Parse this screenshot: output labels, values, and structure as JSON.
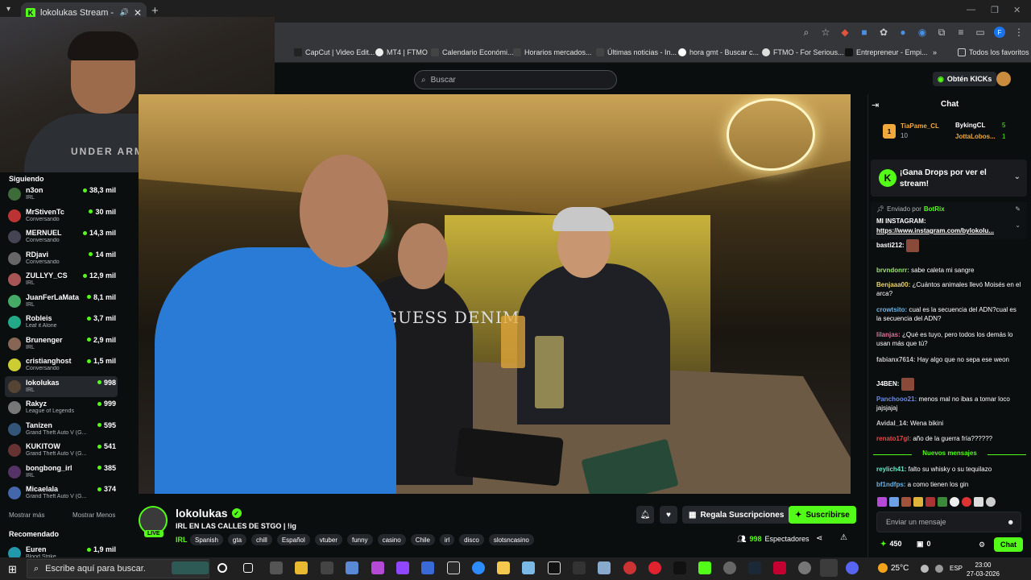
{
  "browser": {
    "tab_title": "lokolukas Stream - Watch L",
    "bookmarks": [
      "CapCut | Video Edit...",
      "MT4 | FTMO",
      "Calendario Económi...",
      "Horarios mercados...",
      "Últimas noticias - In...",
      "hora gmt - Buscar c...",
      "FTMO - For Serious...",
      "Entrepreneur - Empi...",
      "Todos los favoritos"
    ]
  },
  "header": {
    "search_placeholder": "Buscar",
    "get_kicks": "Obtén KICKs"
  },
  "webcam": {
    "shirt_text": "UNDER ARMOUR"
  },
  "sidebar": {
    "following_title": "Siguiendo",
    "following": [
      {
        "name": "n3on",
        "cat": "IRL",
        "viewers": "38,3 mil",
        "color": "#3d6b3a"
      },
      {
        "name": "MrStivenTc",
        "cat": "Conversando",
        "viewers": "30 mil",
        "color": "#b33"
      },
      {
        "name": "MERNUEL",
        "cat": "Conversando",
        "viewers": "14,3 mil",
        "color": "#445"
      },
      {
        "name": "RDjavi",
        "cat": "Conversando",
        "viewers": "14 mil",
        "color": "#666"
      },
      {
        "name": "ZULLYY_CS",
        "cat": "IRL",
        "viewers": "12,9 mil",
        "color": "#a55"
      },
      {
        "name": "JuanFerLaMata",
        "cat": "IRL",
        "viewers": "8,1 mil",
        "color": "#4a6"
      },
      {
        "name": "Robleis",
        "cat": "Leaf it Alone",
        "viewers": "3,7 mil",
        "color": "#2a8"
      },
      {
        "name": "Brunenger",
        "cat": "IRL",
        "viewers": "2,9 mil",
        "color": "#865"
      },
      {
        "name": "cristianghost",
        "cat": "Conversando",
        "viewers": "1,5 mil",
        "color": "#cc3"
      },
      {
        "name": "lokolukas",
        "cat": "IRL",
        "viewers": "998",
        "color": "#543"
      },
      {
        "name": "Rakyz",
        "cat": "League of Legends",
        "viewers": "999",
        "color": "#777"
      },
      {
        "name": "Tanizen",
        "cat": "Grand Theft Auto V (G...",
        "viewers": "595",
        "color": "#357"
      },
      {
        "name": "KUKITOW",
        "cat": "Grand Theft Auto V (G...",
        "viewers": "541",
        "color": "#633"
      },
      {
        "name": "bongbong_irl",
        "cat": "IRL",
        "viewers": "385",
        "color": "#536"
      },
      {
        "name": "Micaelala",
        "cat": "Grand Theft Auto V (G...",
        "viewers": "374",
        "color": "#46a"
      }
    ],
    "show_more": "Mostrar más",
    "show_less": "Mostrar Menos",
    "recommended_title": "Recomendado",
    "recommended": [
      {
        "name": "Euren",
        "cat": "Blood Strike",
        "viewers": "1,9 mil",
        "color": "#29a"
      }
    ]
  },
  "video": {
    "shirt_text": "GUESS DENIM"
  },
  "stream": {
    "name": "lokolukas",
    "live": "LIVE",
    "title": "IRL EN LAS CALLES DE STGO | !ig",
    "category": "IRL",
    "tags": [
      "Spanish",
      "gta",
      "chill",
      "Español",
      "vtuber",
      "funny",
      "casino",
      "Chile",
      "irl",
      "disco",
      "slotsncasino"
    ],
    "gift_label": "Regala Suscripciones",
    "subscribe_label": "Suscribirse",
    "viewers_count": "998",
    "viewers_label": "Espectadores"
  },
  "chat": {
    "title": "Chat",
    "leaderboard": [
      {
        "name": "TiaPame_CL",
        "value": "10",
        "color": "#f2a93b"
      },
      {
        "name": "BykingCL",
        "value": "5",
        "color": "#fff"
      },
      {
        "name": "JottaLobos...",
        "value": "1",
        "color": "#f2a93b"
      }
    ],
    "drops_title": "¡Gana Drops por ver el stream!",
    "pinned_by_label": "Enviado por",
    "pinned_by": "BotRix",
    "pinned_text": "MI INSTAGRAM:",
    "pinned_link": "https://www.instagram.com/bylokolu...",
    "messages": [
      {
        "user": "basti212:",
        "text": "",
        "color": "#fff",
        "emote": true
      },
      {
        "user": "brvndonrr:",
        "text": "sabe caleta mi sangre",
        "color": "#9ae66e"
      },
      {
        "user": "Benjaaa00:",
        "text": "¿Cuántos animales llevó Moisés en el arca?",
        "color": "#e6d36e"
      },
      {
        "user": "crowtsito:",
        "text": "cual es la secuencia del ADN?cual es la secuencia del ADN?",
        "color": "#6eb4e6"
      },
      {
        "user": "lilanjas:",
        "text": "¿Qué es tuyo, pero todos los demás lo usan más que tú?",
        "color": "#e66e9a"
      },
      {
        "user": "fabianx7614:",
        "text": "Hay algo que no sepa ese weon",
        "color": "#c8c8c8"
      },
      {
        "user": "J4BEN:",
        "text": "",
        "color": "#fff",
        "emote": true
      },
      {
        "user": "Panchooo21:",
        "text": "menos mal no ibas a tomar loco jajsjajaj",
        "color": "#6e8ae6"
      },
      {
        "user": "Avidal_14:",
        "text": "Wena bikini",
        "color": "#c8c8c8"
      },
      {
        "user": "renato17gl:",
        "text": "año de la guerra fría??????",
        "color": "#e64a4a"
      }
    ],
    "new_messages_label": "Nuevos mensajes",
    "new_messages": [
      {
        "user": "reylich41:",
        "text": "falto su whisky o su tequilazo",
        "color": "#6ee6c8"
      },
      {
        "user": "bf1ndfps:",
        "text": "a como tienen los gin",
        "color": "#6eb4e6"
      }
    ],
    "input_placeholder": "Enviar un mensaje",
    "points": "450",
    "badge_count": "0",
    "send_label": "Chat"
  },
  "taskbar": {
    "search_placeholder": "Escribe aquí para buscar.",
    "weather": "25°C",
    "lang": "ESP",
    "time": "23:00",
    "date": "27-03-2026"
  }
}
